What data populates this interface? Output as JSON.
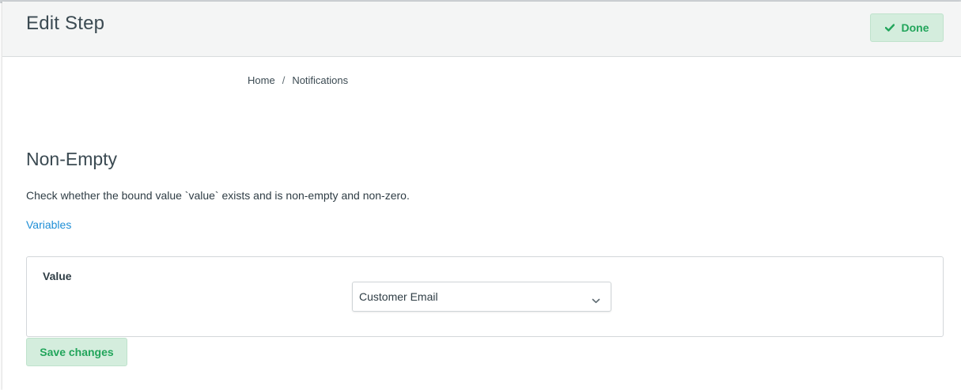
{
  "header": {
    "title": "Edit Step",
    "done_label": "Done"
  },
  "breadcrumb": {
    "items": [
      "Home",
      "Notifications"
    ],
    "separator": "/"
  },
  "section": {
    "title": "Non-Empty",
    "description": "Check whether the bound value `value` exists and is non-empty and non-zero.",
    "variables_link": "Variables"
  },
  "form": {
    "value_label": "Value",
    "value_selected": "Customer Email"
  },
  "actions": {
    "save_label": "Save changes"
  },
  "colors": {
    "accent_green": "#22a55b",
    "button_bg": "#d4eddd",
    "link_blue": "#1f8fd6",
    "header_bg": "#f4f5f5"
  },
  "icons": {
    "done": "checkmark-icon",
    "select": "chevron-down-icon"
  }
}
